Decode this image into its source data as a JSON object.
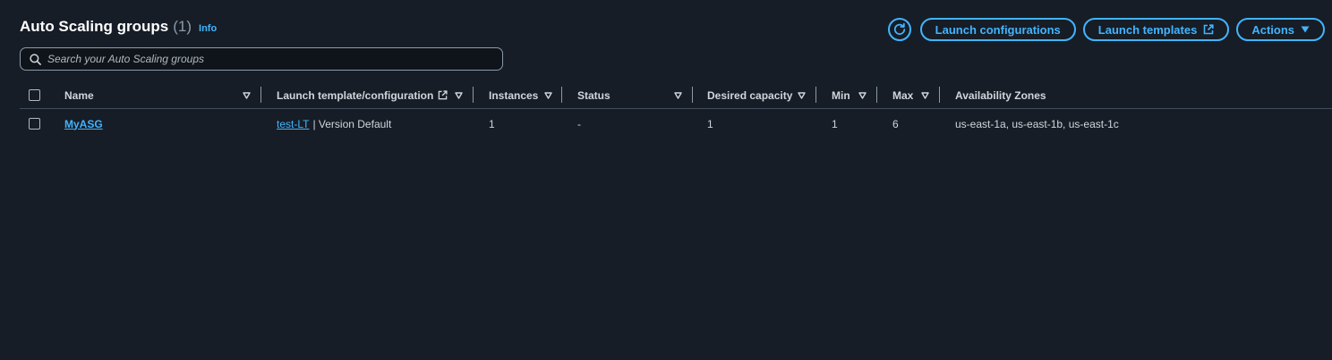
{
  "page": {
    "title": "Auto Scaling groups",
    "count": "(1)",
    "info_label": "Info"
  },
  "toolbar": {
    "refresh_icon": "refresh-icon",
    "launch_configurations_label": "Launch configurations",
    "launch_templates_label": "Launch templates",
    "actions_label": "Actions"
  },
  "search": {
    "placeholder": "Search your Auto Scaling groups",
    "value": ""
  },
  "table": {
    "columns": {
      "name": "Name",
      "launch": "Launch template/configuration",
      "instances": "Instances",
      "status": "Status",
      "desired": "Desired capacity",
      "min": "Min",
      "max": "Max",
      "zones": "Availability Zones"
    },
    "rows": [
      {
        "name": "MyASG",
        "launch_template": "test-LT",
        "launch_version": "| Version Default",
        "instances": "1",
        "status": "-",
        "desired": "1",
        "min": "1",
        "max": "6",
        "zones": "us-east-1a, us-east-1b, us-east-1c"
      }
    ]
  },
  "colors": {
    "background": "#161d26",
    "accent": "#42b4ff",
    "text": "#d1d5db",
    "muted": "#8d99a8"
  }
}
